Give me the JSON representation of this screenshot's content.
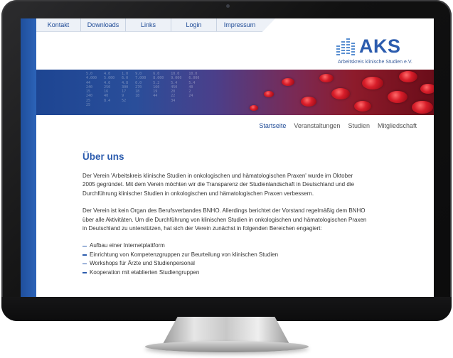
{
  "top_nav": {
    "items": [
      "Kontakt",
      "Downloads",
      "Links",
      "Login",
      "Impressum"
    ]
  },
  "logo": {
    "name": "AKS",
    "tagline": "Arbeitskreis klinische Studien e.V."
  },
  "banner": {
    "data_columns": [
      [
        "5.0",
        "4.000",
        "44",
        "240",
        "15",
        "240",
        "25",
        "25"
      ],
      [
        "4.0",
        "5.000",
        "4.6",
        "250",
        "16",
        "40",
        "8.4",
        ""
      ],
      [
        "1.0",
        "6.0",
        "4.8",
        "300",
        "17",
        "9",
        "52",
        ""
      ],
      [
        "9.0",
        "7.000",
        "6.0",
        "270",
        "18",
        "18",
        "",
        ""
      ],
      [
        "6.0",
        "8.000",
        "5.2",
        "160",
        "19",
        "44",
        "",
        ""
      ],
      [
        "10.0",
        "9.000",
        "5.4",
        "450",
        "20",
        "22",
        "34",
        ""
      ],
      [
        "10.0",
        "6.000",
        "5.4",
        "40",
        "2",
        "24",
        "",
        ""
      ]
    ]
  },
  "sub_nav": {
    "items": [
      "Startseite",
      "Veranstaltungen",
      "Studien",
      "Mitgliedschaft"
    ],
    "active": "Startseite"
  },
  "content": {
    "title": "Über uns",
    "paragraphs": [
      "Der Verein 'Arbeitskreis klinische Studien in onkologischen und hämatologischen Praxen' wurde im Oktober 2005 gegründet. Mit dem Verein möchten wir die Transparenz der Studienlandschaft in Deutschland und die Durchführung klinischer Studien in onkologischen und hämatologischen Praxen verbessern.",
      "Der Verein ist kein Organ des Berufsverbandes BNHO. Allerdings berichtet der Vorstand regelmäßig dem BNHO über alle Aktivitäten. Um die Durchführung von klinischen Studien in onkologischen und hämatologischen Praxen in Deutschland zu unterstützen, hat sich der Verein zunächst in folgenden Bereichen engagiert:"
    ],
    "bullets": [
      "Aufbau einer Internetplattform",
      "Einrichtung von Kompetenzgruppen zur Beurteilung von klinischen Studien",
      "Workshops für Ärzte und Studienpersonal",
      "Kooperation mit etablierten Studiengruppen"
    ]
  }
}
